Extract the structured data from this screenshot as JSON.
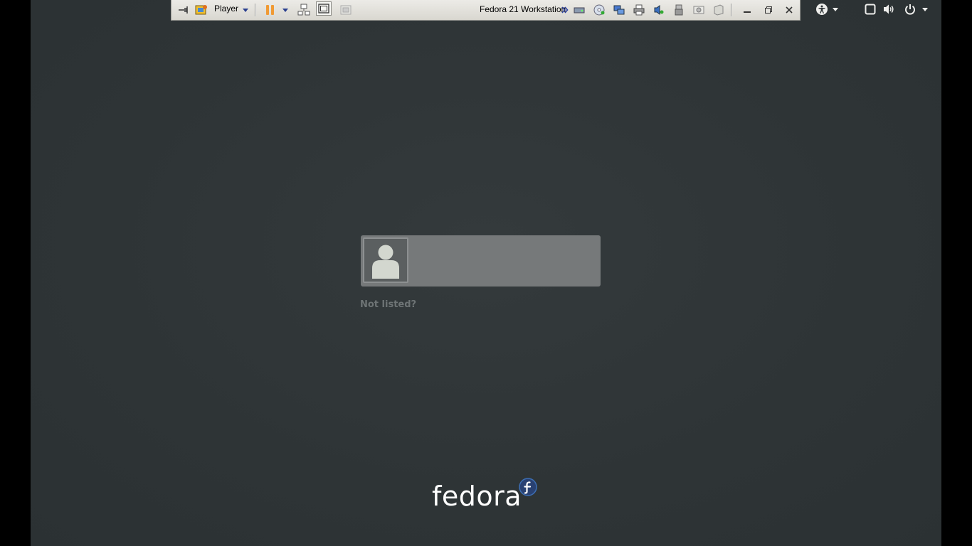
{
  "vm_toolbar": {
    "player_label": "Player",
    "vm_name": "Fedora 21 Workstation",
    "accent_pause": "#f09a34"
  },
  "icons": {
    "pin": "pin-icon",
    "library": "library-icon",
    "player_menu": "chevron-down-icon",
    "pause": "pause-icon",
    "send_ctrl_alt_del": "send-keys-icon",
    "fit_window": "fit-window-icon",
    "unity": "unity-icon",
    "more": "double-chevron-right-icon",
    "minimize": "minimize-icon",
    "restore": "restore-icon",
    "close": "close-icon",
    "accessibility": "accessibility-icon",
    "window": "window-icon",
    "volume": "volume-icon",
    "power": "power-icon"
  },
  "login": {
    "not_listed": "Not listed?"
  },
  "branding": {
    "logo_text": "fedora"
  },
  "colors": {
    "desktop": "#2e3436",
    "user_box": "#76797a",
    "fedora_blue": "#294172"
  }
}
